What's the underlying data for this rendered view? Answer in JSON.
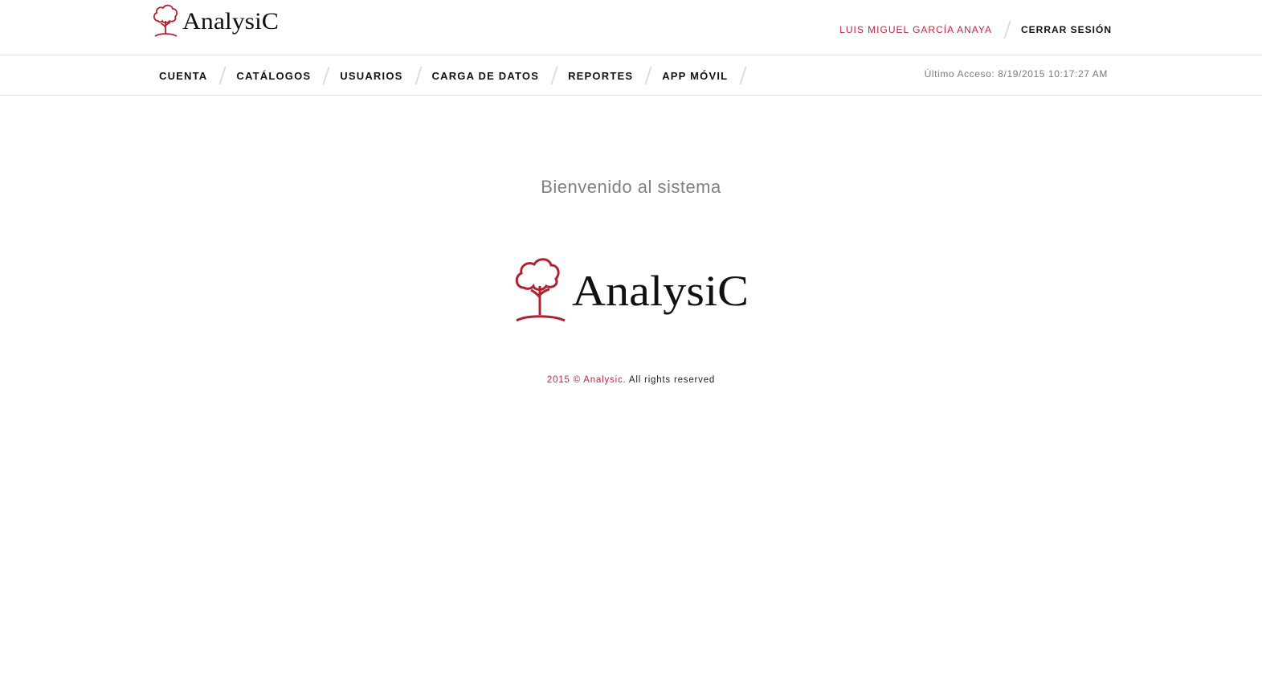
{
  "header": {
    "logo_text": "AnalysiC",
    "user_name": "LUIS MIGUEL GARCÍA ANAYA",
    "logout_label": "CERRAR SESIÓN"
  },
  "nav": {
    "items": [
      {
        "label": "CUENTA"
      },
      {
        "label": "CATÁLOGOS"
      },
      {
        "label": "USUARIOS"
      },
      {
        "label": "CARGA DE DATOS"
      },
      {
        "label": "REPORTES"
      },
      {
        "label": "APP MÓVIL"
      }
    ],
    "last_access": "Último Acceso: 8/19/2015 10:17:27 AM"
  },
  "main": {
    "welcome": "Bienvenido al sistema",
    "logo_text": "AnalysiC"
  },
  "footer": {
    "copyright": "2015 © Analysic.",
    "rights": "All rights reserved"
  },
  "colors": {
    "accent": "#c0283c",
    "text": "#111111",
    "muted": "#808080"
  }
}
